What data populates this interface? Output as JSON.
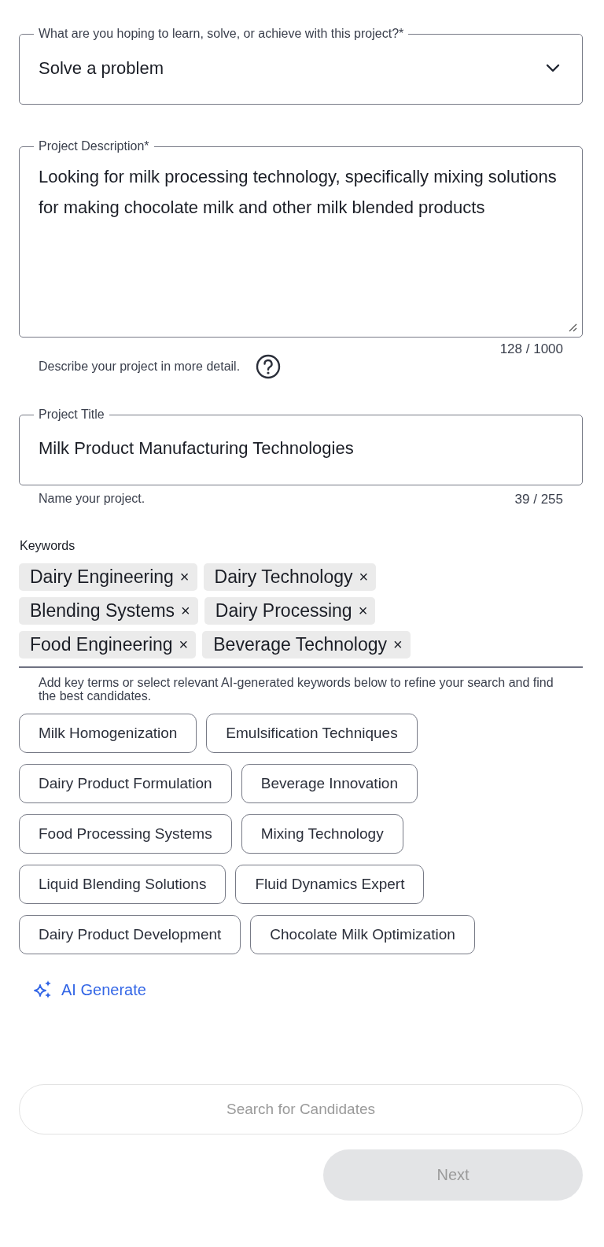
{
  "goal_select": {
    "label": "What are you hoping to learn, solve, or achieve with this project?*",
    "value": "Solve a problem"
  },
  "description": {
    "label": "Project Description*",
    "value": "Looking for milk processing technology, specifically mixing solutions for making chocolate milk and other milk blended products",
    "counter": "128 / 1000",
    "helper": "Describe your project in more detail."
  },
  "title_field": {
    "label": "Project Title",
    "value": "Milk Product Manufacturing Technologies",
    "helper": "Name your project.",
    "counter": "39 / 255"
  },
  "keywords": {
    "label": "Keywords",
    "selected": [
      {
        "label": "Dairy Engineering",
        "remove": "×"
      },
      {
        "label": "Dairy Technology",
        "remove": "×"
      },
      {
        "label": "Blending Systems",
        "remove": "×"
      },
      {
        "label": "Dairy Processing",
        "remove": "×"
      },
      {
        "label": "Food Engineering",
        "remove": "×"
      },
      {
        "label": "Beverage Technology",
        "remove": "×"
      }
    ],
    "hint": "Add key terms or select relevant AI-generated keywords below to refine your search and find the best candidates.",
    "suggestions": [
      "Milk Homogenization",
      "Emulsification Techniques",
      "Dairy Product Formulation",
      "Beverage Innovation",
      "Food Processing Systems",
      "Mixing Technology",
      "Liquid Blending Solutions",
      "Fluid Dynamics Expert",
      "Dairy Product Development",
      "Chocolate Milk Optimization"
    ],
    "ai_generate": "AI Generate"
  },
  "search_button": {
    "label": "Search for Candidates",
    "disabled": true
  },
  "next_button": {
    "label": "Next",
    "disabled": true
  }
}
